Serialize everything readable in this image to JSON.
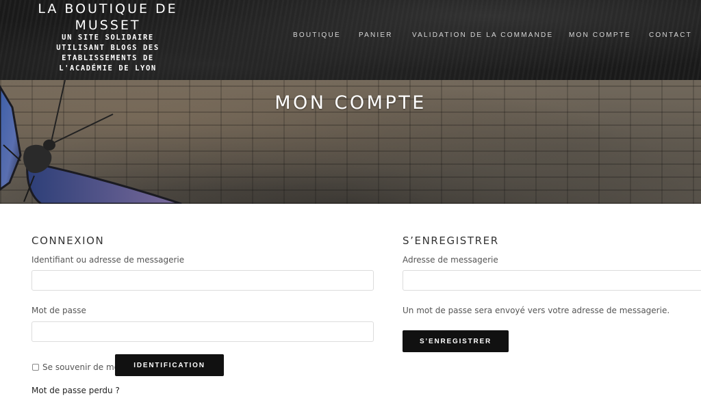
{
  "site": {
    "title_line1": "LA BOUTIQUE DE",
    "title_line2": "MUSSET",
    "tagline": "UN SITE SOLIDAIRE UTILISANT BLOGS DES ETABLISSEMENTS DE L'ACADÉMIE DE LYON"
  },
  "nav": {
    "items": [
      {
        "label": "BOUTIQUE"
      },
      {
        "label": "PANIER"
      },
      {
        "label": "VALIDATION DE LA COMMANDE"
      },
      {
        "label": "MON COMPTE"
      },
      {
        "label": "CONTACT"
      }
    ]
  },
  "hero": {
    "title": "MON COMPTE"
  },
  "login": {
    "heading": "CONNEXION",
    "username_label": "Identifiant ou adresse de messagerie",
    "username_value": "",
    "password_label": "Mot de passe",
    "password_value": "",
    "remember_label": "Se souvenir de moi",
    "remember_checked": false,
    "submit_label": "IDENTIFICATION",
    "lost_password_label": "Mot de passe perdu ?"
  },
  "register": {
    "heading": "S’ENREGISTRER",
    "email_label": "Adresse de messagerie",
    "email_value": "",
    "note": "Un mot de passe sera envoyé vers votre adresse de messagerie.",
    "submit_label": "S’ENREGISTRER"
  },
  "colors": {
    "header_bg": "#1a1a1a",
    "button_bg": "#111111",
    "text": "#555555",
    "heading": "#333333"
  }
}
